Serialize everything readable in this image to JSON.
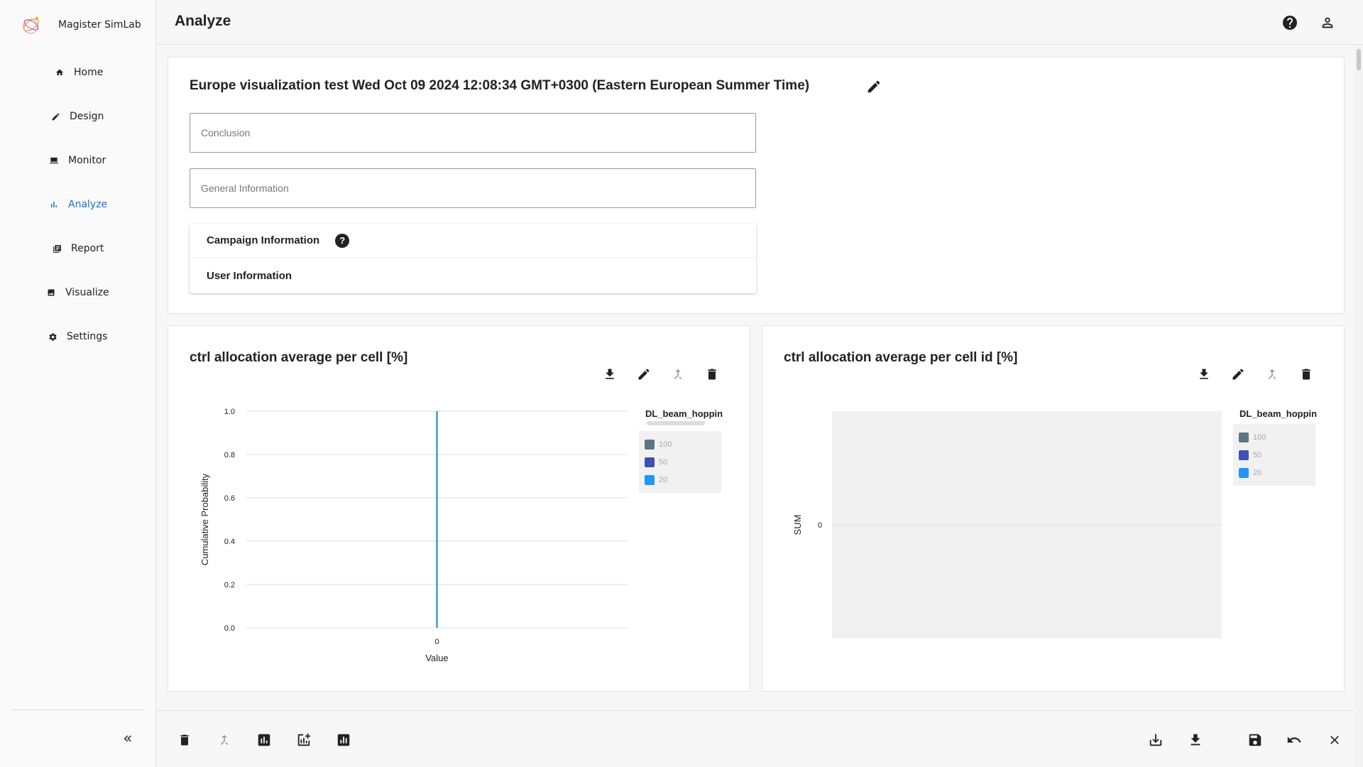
{
  "app": {
    "name": "Magister SimLab"
  },
  "nav": {
    "items": [
      {
        "label": "Home",
        "icon": "home-icon"
      },
      {
        "label": "Design",
        "icon": "pencil-icon"
      },
      {
        "label": "Monitor",
        "icon": "laptop-icon"
      },
      {
        "label": "Analyze",
        "icon": "bar-chart-icon",
        "active": true
      },
      {
        "label": "Report",
        "icon": "report-icon"
      },
      {
        "label": "Visualize",
        "icon": "image-icon"
      },
      {
        "label": "Settings",
        "icon": "gear-icon"
      }
    ],
    "collapse_icon": "double-chevron-left-icon"
  },
  "header": {
    "title": "Analyze",
    "help_icon": "help-circle-icon",
    "user_icon": "account-icon"
  },
  "analysis": {
    "title": "Europe visualization test Wed Oct 09 2024 12:08:34 GMT+0300 (Eastern European Summer Time)",
    "conclusion_placeholder": "Conclusion",
    "general_info_placeholder": "General Information",
    "campaign_info_label": "Campaign Information",
    "user_info_label": "User Information",
    "help_glyph": "?"
  },
  "charts": [
    {
      "title": "ctrl allocation average per cell [%]",
      "legend": {
        "title": "DL_beam_hoppin",
        "items": [
          "100",
          "50",
          "20"
        ]
      }
    },
    {
      "title": "ctrl allocation average per cell id [%]",
      "legend": {
        "title": "DL_beam_hoppin",
        "items": [
          "100",
          "50",
          "20"
        ]
      }
    }
  ],
  "chart_data": [
    {
      "type": "line",
      "xlabel": "Value",
      "ylabel": "Cumulative Probability",
      "ylim": [
        0,
        1
      ],
      "y_ticks": [
        "0.0",
        "0.2",
        "0.4",
        "0.6",
        "0.8",
        "1.0"
      ],
      "x_ticks": [
        "0"
      ],
      "series": [
        {
          "name": "100",
          "color": "#5f7482",
          "x": [],
          "y": []
        },
        {
          "name": "50",
          "color": "#3f51b5",
          "x": [],
          "y": []
        },
        {
          "name": "20",
          "color": "#2196f3",
          "x": [
            0,
            0
          ],
          "y": [
            0,
            1
          ]
        }
      ],
      "grid": true,
      "legend_position": "right"
    },
    {
      "type": "bar",
      "xlabel": "",
      "ylabel": "SUM",
      "y_ticks": [
        "0"
      ],
      "categories": [],
      "series": [
        {
          "name": "100",
          "color": "#5f7482",
          "values": []
        },
        {
          "name": "50",
          "color": "#3f51b5",
          "values": []
        },
        {
          "name": "20",
          "color": "#2196f3",
          "values": []
        }
      ],
      "legend_position": "right"
    }
  ],
  "colors": {
    "accent": "#1a73c9",
    "series_100": "#5f7482",
    "series_50": "#3f51b5",
    "series_20": "#2196f3",
    "plot_bg": "#f1f1f1"
  }
}
